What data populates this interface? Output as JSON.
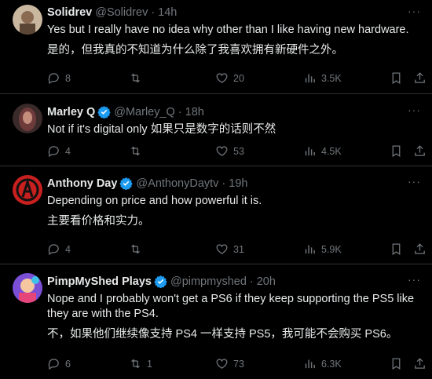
{
  "tweets": [
    {
      "name": "Solidrev",
      "handle": "@Solidrev",
      "time": "14h",
      "verified": false,
      "text": "Yes but I really have no idea why other than I like having new hardware.",
      "translation": "是的，但我真的不知道为什么除了我喜欢拥有新硬件之外。",
      "replies": "8",
      "retweets": "",
      "likes": "20",
      "views": "3.5K"
    },
    {
      "name": "Marley Q",
      "handle": "@Marley_Q",
      "time": "18h",
      "verified": true,
      "text": "Not if it's digital only 如果只是数字的话则不然",
      "translation": "",
      "replies": "4",
      "retweets": "",
      "likes": "53",
      "views": "4.5K"
    },
    {
      "name": "Anthony Day",
      "handle": "@AnthonyDaytv",
      "time": "19h",
      "verified": true,
      "text": "Depending on price and how powerful it is.",
      "translation": "主要看价格和实力。",
      "replies": "4",
      "retweets": "",
      "likes": "31",
      "views": "5.9K"
    },
    {
      "name": "PimpMyShed Plays",
      "handle": "@pimpmyshed",
      "time": "20h",
      "verified": true,
      "text": "Nope and I probably won't get a PS6 if they keep supporting the PS5 like they are with the PS4.",
      "translation": "不，如果他们继续像支持 PS4 一样支持 PS5，我可能不会购买 PS6。",
      "replies": "6",
      "retweets": "1",
      "likes": "73",
      "views": "6.3K"
    }
  ],
  "colors": {
    "background": "#000000",
    "text": "#e7e9ea",
    "muted": "#71767b",
    "verified": "#1d9bf0",
    "divider": "#2f3336"
  },
  "separator": "·",
  "more_label": "···"
}
